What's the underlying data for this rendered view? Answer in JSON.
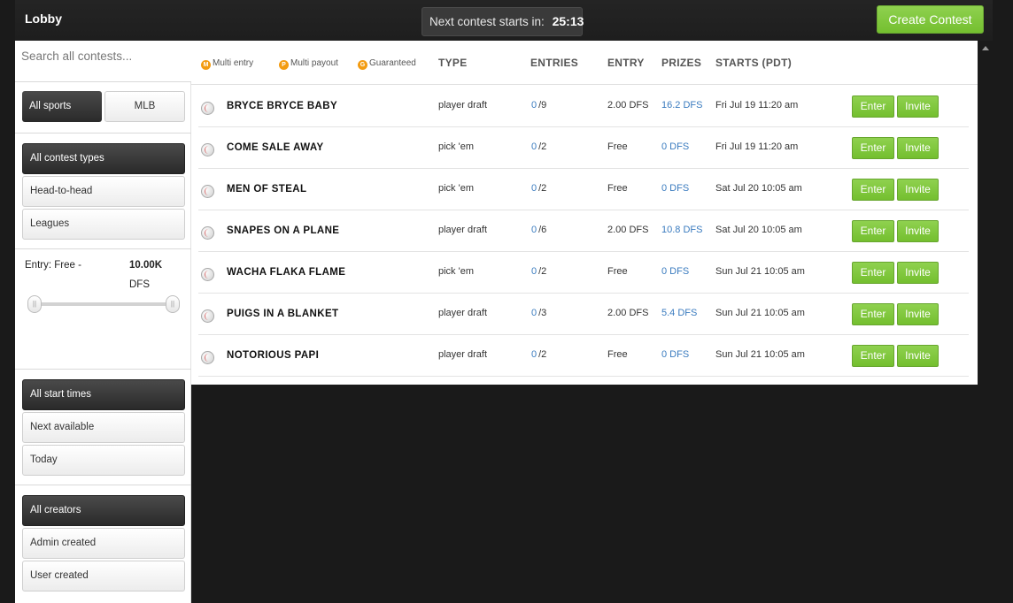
{
  "header": {
    "title": "Lobby",
    "countdown_label": "Next contest starts in:",
    "countdown_time": "25:13",
    "create_label": "Create Contest"
  },
  "sidebar": {
    "search_placeholder": "Search all contests...",
    "sports": {
      "all": "All sports",
      "mlb": "MLB"
    },
    "contest_types": [
      "All contest types",
      "Head-to-head",
      "Leagues"
    ],
    "entry": {
      "label": "Entry: Free -",
      "max": "10.00K",
      "unit": "DFS",
      "handle_glyph": "||"
    },
    "start_times": [
      "All start times",
      "Next available",
      "Today"
    ],
    "creators": [
      "All creators",
      "Admin created",
      "User created"
    ]
  },
  "legend": [
    {
      "badge": "M",
      "label": "Multi entry"
    },
    {
      "badge": "P",
      "label": "Multi payout"
    },
    {
      "badge": "G",
      "label": "Guaranteed"
    }
  ],
  "columns": {
    "type": "TYPE",
    "entries": "ENTRIES",
    "entry": "ENTRY",
    "prizes": "PRIZES",
    "starts": "STARTS (PDT)"
  },
  "buttons": {
    "enter": "Enter",
    "invite": "Invite"
  },
  "contests": [
    {
      "name": "BRYCE BRYCE BABY",
      "type": "player draft",
      "entries": "0",
      "max": "/9",
      "entry": "2.00 DFS",
      "prizes": "16.2 DFS",
      "starts": "Fri Jul 19 11:20 am"
    },
    {
      "name": "COME SALE AWAY",
      "type": "pick 'em",
      "entries": "0",
      "max": "/2",
      "entry": "Free",
      "prizes": "0 DFS",
      "starts": "Fri Jul 19 11:20 am"
    },
    {
      "name": "MEN OF STEAL",
      "type": "pick 'em",
      "entries": "0",
      "max": "/2",
      "entry": "Free",
      "prizes": "0 DFS",
      "starts": "Sat Jul 20 10:05 am"
    },
    {
      "name": "SNAPES ON A PLANE",
      "type": "player draft",
      "entries": "0",
      "max": "/6",
      "entry": "2.00 DFS",
      "prizes": "10.8 DFS",
      "starts": "Sat Jul 20 10:05 am"
    },
    {
      "name": "WACHA FLAKA FLAME",
      "type": "pick 'em",
      "entries": "0",
      "max": "/2",
      "entry": "Free",
      "prizes": "0 DFS",
      "starts": "Sun Jul 21 10:05 am"
    },
    {
      "name": "PUIGS IN A BLANKET",
      "type": "player draft",
      "entries": "0",
      "max": "/3",
      "entry": "2.00 DFS",
      "prizes": "5.4 DFS",
      "starts": "Sun Jul 21 10:05 am"
    },
    {
      "name": "NOTORIOUS PAPI",
      "type": "player draft",
      "entries": "0",
      "max": "/2",
      "entry": "Free",
      "prizes": "0 DFS",
      "starts": "Sun Jul 21 10:05 am"
    }
  ],
  "colors": {
    "accent_green": "#7dc63b",
    "link_blue": "#3a7bbf",
    "badge_orange": "#f39c12",
    "dark_bg": "#1a1a1a"
  }
}
